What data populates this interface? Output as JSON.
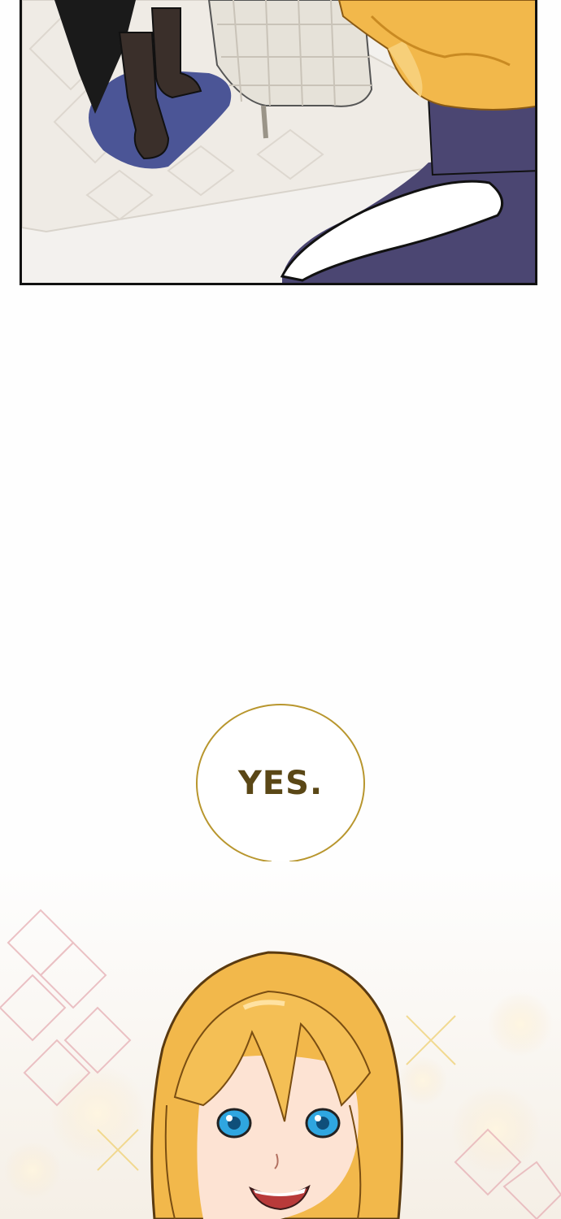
{
  "panels": [
    {
      "name": "top-panel",
      "description_visible": false
    },
    {
      "name": "bottom-scene"
    }
  ],
  "speech_bubble": {
    "text": "YES."
  },
  "colors": {
    "bubble_border": "#b8962e",
    "bubble_text": "#5a4716",
    "hair": "#f2b84b",
    "eyes": "#2fa6e0",
    "coat": "#4b4672"
  }
}
